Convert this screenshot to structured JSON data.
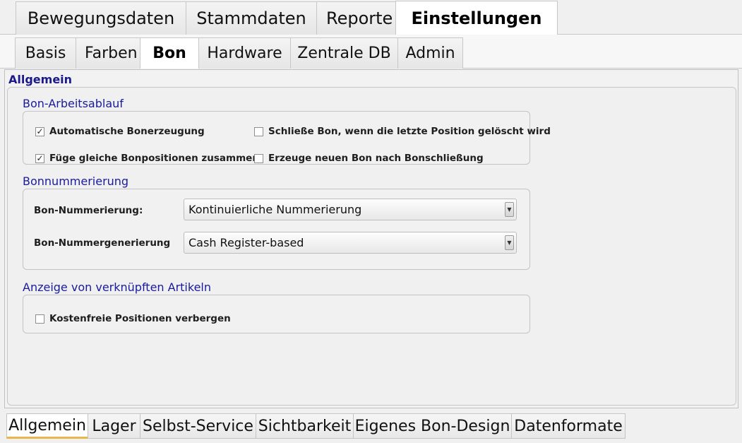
{
  "top_tabs": [
    {
      "label": "Bewegungsdaten",
      "active": false
    },
    {
      "label": "Stammdaten",
      "active": false
    },
    {
      "label": "Reporte",
      "active": false
    },
    {
      "label": "Einstellungen",
      "active": true
    }
  ],
  "sub_tabs": [
    {
      "label": "Basis",
      "active": false
    },
    {
      "label": "Farben",
      "active": false
    },
    {
      "label": "Bon",
      "active": true
    },
    {
      "label": "Hardware",
      "active": false
    },
    {
      "label": "Zentrale DB",
      "active": false
    },
    {
      "label": "Admin",
      "active": false
    }
  ],
  "panel": {
    "title": "Allgemein",
    "workflow": {
      "title": "Bon-Arbeitsablauf",
      "options": [
        {
          "label": "Automatische Bonerzeugung",
          "checked": true
        },
        {
          "label": "Schließe Bon, wenn die letzte Position gelöscht wird",
          "checked": false
        },
        {
          "label": "Füge gleiche Bonpositionen zusammen",
          "checked": true
        },
        {
          "label": "Erzeuge neuen Bon nach Bonschließung",
          "checked": false
        }
      ]
    },
    "numbering": {
      "title": "Bonnummerierung",
      "fields": [
        {
          "label": "Bon-Nummerierung:",
          "value": "Kontinuierliche Nummerierung"
        },
        {
          "label": "Bon-Nummergenerierung",
          "value": "Cash Register-based"
        }
      ]
    },
    "linked": {
      "title": "Anzeige von verknüpften Artikeln",
      "options": [
        {
          "label": "Kostenfreie Positionen verbergen",
          "checked": false
        }
      ]
    }
  },
  "bottom_tabs": [
    {
      "label": "Allgemein",
      "active": true
    },
    {
      "label": "Lager",
      "active": false
    },
    {
      "label": "Selbst-Service",
      "active": false
    },
    {
      "label": "Sichtbarkeit",
      "active": false
    },
    {
      "label": "Eigenes Bon-Design",
      "active": false
    },
    {
      "label": "Datenformate",
      "active": false
    }
  ],
  "icons": {
    "checked": "check-mark-icon",
    "dropdown": "chevron-down-icon"
  },
  "colors": {
    "group_title": "#1a1a9e",
    "active_tab_underline": "#e8b64a"
  }
}
